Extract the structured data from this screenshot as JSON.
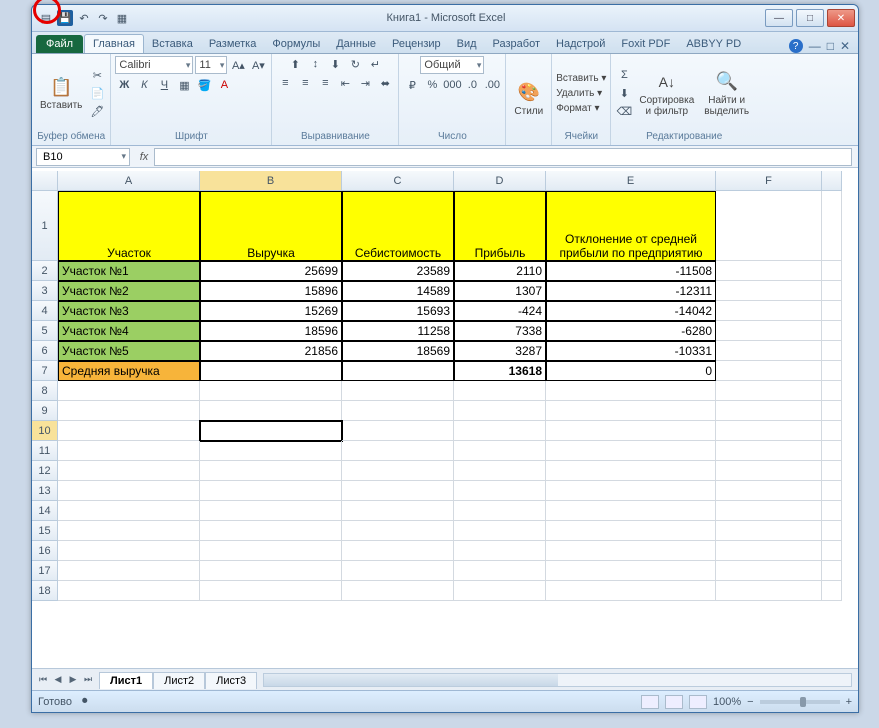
{
  "title": "Книга1  -  Microsoft Excel",
  "qat": {
    "save": "💾",
    "undo": "↶",
    "redo": "↷",
    "custom": "▦"
  },
  "winbtns": {
    "min": "—",
    "max": "□",
    "close": "✕"
  },
  "tabs": {
    "file": "Файл",
    "items": [
      "Главная",
      "Вставка",
      "Разметка",
      "Формулы",
      "Данные",
      "Рецензир",
      "Вид",
      "Разработ",
      "Надстрой",
      "Foxit PDF",
      "ABBYY PD"
    ],
    "active": 0,
    "help": "?"
  },
  "ribbon": {
    "clipboard": {
      "paste": "Вставить",
      "label": "Буфер обмена",
      "cut": "✂",
      "copy": "📄",
      "fmt": "🖊"
    },
    "font": {
      "name": "Calibri",
      "size": "11",
      "label": "Шрифт",
      "bold": "Ж",
      "italic": "К",
      "underline": "Ч"
    },
    "align": {
      "label": "Выравнивание"
    },
    "number": {
      "fmt": "Общий",
      "label": "Число"
    },
    "styles": {
      "btn": "Стили",
      "label": ""
    },
    "cells": {
      "insert": "Вставить ▾",
      "delete": "Удалить ▾",
      "format": "Формат ▾",
      "label": "Ячейки"
    },
    "editing": {
      "sort": "Сортировка\nи фильтр",
      "find": "Найти и\nвыделить",
      "label": "Редактирование"
    }
  },
  "namebox": "B10",
  "fx": "fx",
  "columns": [
    "A",
    "B",
    "C",
    "D",
    "E",
    "F"
  ],
  "headers": {
    "A": "Участок",
    "B": "Выручка",
    "C": "Себистоимость",
    "D": "Прибыль",
    "E": "Отклонение от средней прибыли по предприятию"
  },
  "rows": [
    {
      "A": "Участок №1",
      "B": "25699",
      "C": "23589",
      "D": "2110",
      "E": "-11508"
    },
    {
      "A": "Участок №2",
      "B": "15896",
      "C": "14589",
      "D": "1307",
      "E": "-12311"
    },
    {
      "A": "Участок №3",
      "B": "15269",
      "C": "15693",
      "D": "-424",
      "E": "-14042"
    },
    {
      "A": "Участок №4",
      "B": "18596",
      "C": "11258",
      "D": "7338",
      "E": "-6280"
    },
    {
      "A": "Участок №5",
      "B": "21856",
      "C": "18569",
      "D": "3287",
      "E": "-10331"
    }
  ],
  "summary": {
    "A": "Средняя выручка",
    "D": "13618",
    "E": "0"
  },
  "sheets": {
    "nav": [
      "⏮",
      "◀",
      "▶",
      "⏭"
    ],
    "tabs": [
      "Лист1",
      "Лист2",
      "Лист3"
    ],
    "active": 0
  },
  "status": {
    "ready": "Готово",
    "zoom": "100%",
    "minus": "−",
    "plus": "+"
  },
  "chart_data": {
    "type": "table",
    "columns": [
      "Участок",
      "Выручка",
      "Себистоимость",
      "Прибыль",
      "Отклонение от средней прибыли по предприятию"
    ],
    "rows": [
      [
        "Участок №1",
        25699,
        23589,
        2110,
        -11508
      ],
      [
        "Участок №2",
        15896,
        14589,
        1307,
        -12311
      ],
      [
        "Участок №3",
        15269,
        15693,
        -424,
        -14042
      ],
      [
        "Участок №4",
        18596,
        11258,
        7338,
        -6280
      ],
      [
        "Участок №5",
        21856,
        18569,
        3287,
        -10331
      ],
      [
        "Средняя выручка",
        null,
        null,
        13618,
        0
      ]
    ]
  }
}
